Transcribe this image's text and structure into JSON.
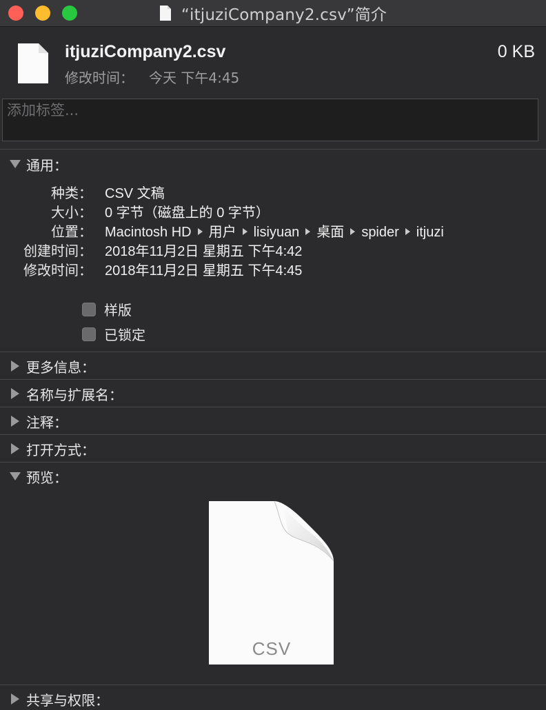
{
  "window": {
    "title": "“itjuziCompany2.csv”简介",
    "controls": [
      "close",
      "minimize",
      "maximize"
    ]
  },
  "header": {
    "file_name": "itjuziCompany2.csv",
    "file_size": "0 KB",
    "modified_label": "修改时间：",
    "modified_value": "今天 下午4:45"
  },
  "tags": {
    "placeholder": "添加标签...",
    "value": ""
  },
  "sections": {
    "general": {
      "label": "通用：",
      "expanded": true,
      "rows": [
        {
          "key": "种类：",
          "value": "CSV 文稿"
        },
        {
          "key": "大小：",
          "value": "0 字节（磁盘上的 0 字节）"
        },
        {
          "key": "创建时间：",
          "value": "2018年11月2日 星期五 下午4:42"
        },
        {
          "key": "修改时间：",
          "value": "2018年11月2日 星期五 下午4:45"
        }
      ],
      "location_key": "位置：",
      "location_path": [
        "Macintosh HD",
        "用户",
        "lisiyuan",
        "桌面",
        "spider",
        "itjuzi"
      ],
      "stationery_label": "样版",
      "stationery_checked": false,
      "locked_label": "已锁定",
      "locked_checked": false
    },
    "more_info": {
      "label": "更多信息：",
      "expanded": false
    },
    "name_ext": {
      "label": "名称与扩展名：",
      "expanded": false
    },
    "comments": {
      "label": "注释：",
      "expanded": false
    },
    "open_with": {
      "label": "打开方式：",
      "expanded": false
    },
    "preview": {
      "label": "预览：",
      "expanded": true,
      "file_type_label": "CSV"
    },
    "sharing": {
      "label": "共享与权限：",
      "expanded": false
    }
  },
  "colors": {
    "background": "#2b2b2d",
    "titlebar": "#38383a",
    "close": "#fe5f57",
    "minimize": "#febc2e",
    "maximize": "#28c840"
  }
}
